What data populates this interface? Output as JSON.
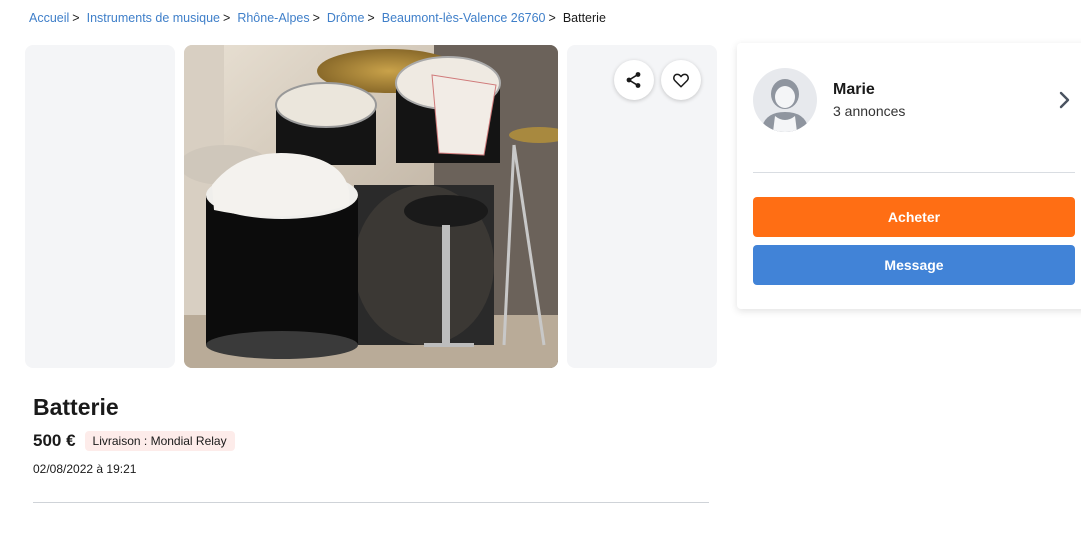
{
  "breadcrumb": {
    "items": [
      "Accueil",
      "Instruments de musique",
      "Rhône-Alpes",
      "Drôme",
      "Beaumont-lès-Valence 26760"
    ],
    "separator": ">",
    "current": "Batterie"
  },
  "listing": {
    "title": "Batterie",
    "price": "500 €",
    "delivery_badge": "Livraison : Mondial Relay",
    "date": "02/08/2022 à 19:21",
    "photo_alt": "Batterie"
  },
  "actions": {
    "share_icon": "share-icon",
    "favorite_icon": "heart-icon"
  },
  "seller": {
    "name": "Marie",
    "ads_count": "3 annonces"
  },
  "buttons": {
    "buy": "Acheter",
    "message": "Message"
  },
  "colors": {
    "link": "#3f7fc9",
    "buy": "#ff6e14",
    "message": "#4183d7",
    "badge_bg": "#fdecea"
  }
}
